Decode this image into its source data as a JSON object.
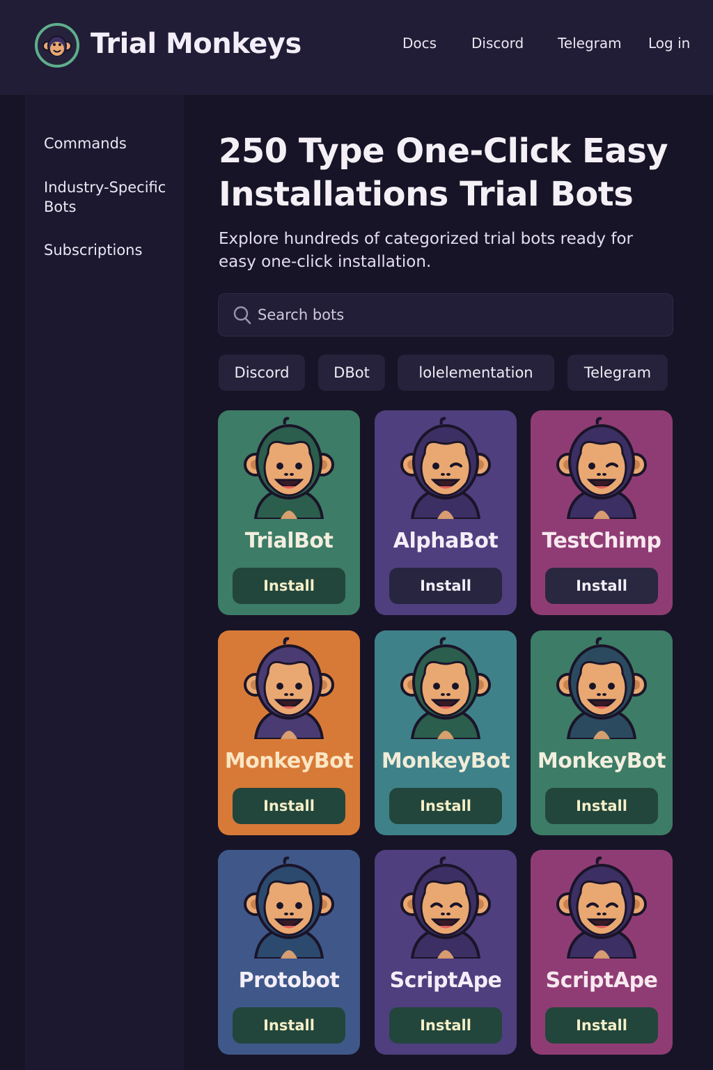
{
  "header": {
    "brand": "Trial Monkeys",
    "nav": [
      "Docs",
      "Discord",
      "Telegram",
      "Log in"
    ]
  },
  "sidebar": {
    "items": [
      "Commands",
      "Industry-Specific Bots",
      "Subscriptions"
    ]
  },
  "main": {
    "title": "250 Type One-Click Easy Installations Trial Bots",
    "subtitle": "Explore hundreds of categorized trial bots ready for easy one-click installation.",
    "search": {
      "placeholder": "Search bots",
      "value": ""
    },
    "filters": [
      "Discord",
      "DBot",
      "lolelementation",
      "Telegram"
    ],
    "bots": [
      {
        "name": "TrialBot",
        "button": "Install",
        "card_color": "#3d7c66",
        "fur_color": "#2b5e4c",
        "name_color": "#f3eedf",
        "button_bg": "#22463b",
        "button_text": "#f5efc8"
      },
      {
        "name": "AlphaBot",
        "button": "Install",
        "card_color": "#4f3f7e",
        "fur_color": "#3c2f63",
        "name_color": "#f3eef7",
        "button_bg": "#282540",
        "button_text": "#f2eef6"
      },
      {
        "name": "TestChimp",
        "button": "Install",
        "card_color": "#8f3c75",
        "fur_color": "#3c2f63",
        "name_color": "#f8e9ee",
        "button_bg": "#2a2740",
        "button_text": "#f2eef6"
      },
      {
        "name": "MonkeyBot",
        "button": "Install",
        "card_color": "#d87a37",
        "fur_color": "#4a3c72",
        "name_color": "#fbe6c4",
        "button_bg": "#22463b",
        "button_text": "#f5efc8"
      },
      {
        "name": "MonkeyBot",
        "button": "Install",
        "card_color": "#3f8189",
        "fur_color": "#2b5e4c",
        "name_color": "#f0ecd8",
        "button_bg": "#22463b",
        "button_text": "#f5efc8"
      },
      {
        "name": "MonkeyBot",
        "button": "Install",
        "card_color": "#3d7c66",
        "fur_color": "#2b4a60",
        "name_color": "#f3eedf",
        "button_bg": "#22463b",
        "button_text": "#f5efc8"
      },
      {
        "name": "Protobot",
        "button": "Install",
        "card_color": "#3f5889",
        "fur_color": "#2b4a6e",
        "name_color": "#f3eef7",
        "button_bg": "#22463b",
        "button_text": "#f5efc8"
      },
      {
        "name": "ScriptApe",
        "button": "Install",
        "card_color": "#4f3f7e",
        "fur_color": "#3c2f63",
        "name_color": "#f3eef7",
        "button_bg": "#22463b",
        "button_text": "#f5efc8"
      },
      {
        "name": "ScriptApe",
        "button": "Install",
        "card_color": "#8f3c75",
        "fur_color": "#3c2f63",
        "name_color": "#f8e9ee",
        "button_bg": "#22463b",
        "button_text": "#f5efc8"
      }
    ]
  },
  "colors": {
    "page_bg": "#171427",
    "header_bg": "#211d36",
    "sidebar_bg": "#1b1830",
    "logo_ring": "#5fae8c",
    "monkey_face": "#e9a872"
  },
  "icons": {
    "logo": "monkey-face-icon",
    "search": "search-icon",
    "bot_avatar": "monkey-avatar-icon"
  }
}
